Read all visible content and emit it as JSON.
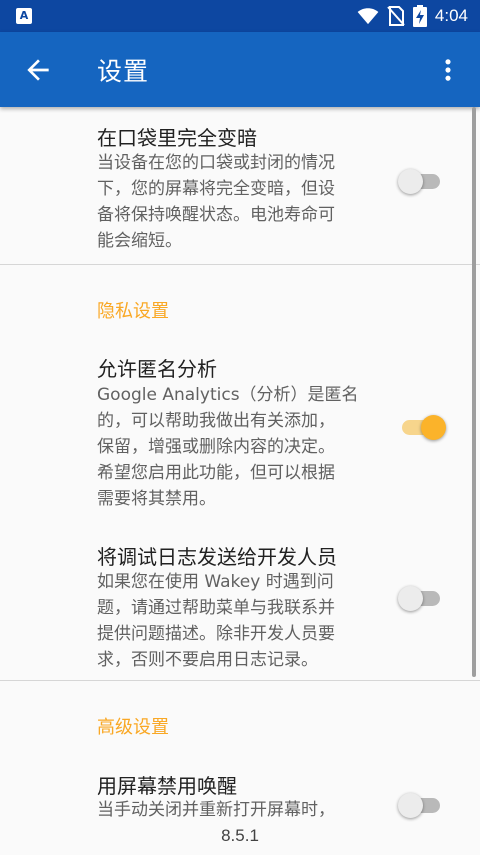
{
  "status_bar": {
    "app_badge": "A",
    "time": "4:04",
    "icons": [
      "wifi-icon",
      "no-sim-icon",
      "battery-charging-icon"
    ]
  },
  "app_bar": {
    "title": "设置",
    "back_icon": "arrow-back-icon",
    "more_icon": "more-vert-icon"
  },
  "preferences": [
    {
      "title": "在口袋里完全变暗",
      "summary": [
        "当设备在您的口袋或封闭的情况",
        "下，您的屏幕将完全变暗，但设",
        "备将保持唤醒状态。电池寿命可",
        "能会缩短。"
      ],
      "checked": false
    },
    {
      "title": "允许匿名分析",
      "summary": [
        "Google Analytics（分析）是匿名",
        "的，可以帮助我做出有关添加，",
        "保留，增强或删除内容的决定。",
        "希望您启用此功能，但可以根据",
        "需要将其禁用。"
      ],
      "checked": true
    },
    {
      "title": "将调试日志发送给开发人员",
      "summary": [
        "如果您在使用 Wakey 时遇到问",
        "题，请通过帮助菜单与我联系并",
        "提供问题描述。除非开发人员要",
        "求，否则不要启用日志记录。"
      ],
      "checked": false
    },
    {
      "title": "用屏幕禁用唤醒",
      "summary": [
        "当手动关闭并重新打开屏幕时，"
      ],
      "checked": false
    }
  ],
  "categories": {
    "privacy": "隐私设置",
    "advanced": "高级设置"
  },
  "version": "8.5.1",
  "colors": {
    "status_bar": "#0d47a1",
    "app_bar": "#1565c0",
    "accent": "#fbb32a",
    "category_text": "#f9a825",
    "background": "#fafafa"
  }
}
